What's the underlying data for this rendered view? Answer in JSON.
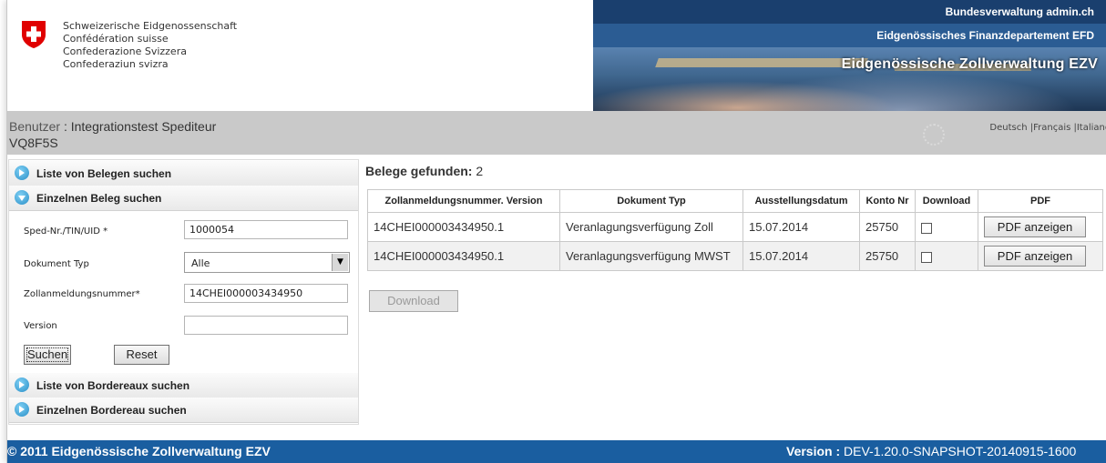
{
  "header": {
    "confederation_lines": [
      "Schweizerische Eidgenossenschaft",
      "Confédération suisse",
      "Confederazione Svizzera",
      "Confederaziun svizra"
    ],
    "admin_link": "Bundesverwaltung admin.ch",
    "department": "Eidgenössisches Finanzdepartement EFD",
    "office": "Eidgenössische Zollverwaltung EZV",
    "flag_color": "#e00000"
  },
  "userbar": {
    "user_label": "Benutzer",
    "user_name": ": Integrationstest Spediteur",
    "user_code": "VQ8F5S",
    "languages": "Deutsch |Français |Italiano"
  },
  "sidebar": {
    "sections": [
      {
        "label": "Liste von Belegen suchen"
      },
      {
        "label": "Einzelnen Beleg suchen"
      },
      {
        "label": "Liste von Bordereaux suchen"
      },
      {
        "label": "Einzelnen Bordereau suchen"
      }
    ],
    "form": {
      "sped_label": "Sped-Nr./TIN/UID *",
      "sped_value": "1000054",
      "doc_type_label": "Dokument Typ",
      "doc_type_value": "Alle",
      "zoll_label": "Zollanmeldungsnummer*",
      "zoll_value": "14CHEI000003434950",
      "version_label": "Version",
      "version_value": "",
      "search_button": "Suchen",
      "reset_button": "Reset"
    }
  },
  "results": {
    "title_label": "Belege gefunden:",
    "count": "2",
    "columns": [
      "Zollanmeldungsnummer. Version",
      "Dokument Typ",
      "Ausstellungsdatum",
      "Konto Nr",
      "Download",
      "PDF"
    ],
    "rows": [
      {
        "nummer": "14CHEI000003434950.1",
        "typ": "Veranlagungsverfügung Zoll",
        "datum": "15.07.2014",
        "konto": "25750",
        "pdf": "PDF anzeigen"
      },
      {
        "nummer": "14CHEI000003434950.1",
        "typ": "Veranlagungsverfügung MWST",
        "datum": "15.07.2014",
        "konto": "25750",
        "pdf": "PDF anzeigen"
      }
    ],
    "download_button": "Download"
  },
  "footer": {
    "copyright": "© 2011 Eidgenössische Zollverwaltung EZV",
    "version_label": "Version :",
    "version_value": "DEV-1.20.0-SNAPSHOT-20140915-1600"
  }
}
